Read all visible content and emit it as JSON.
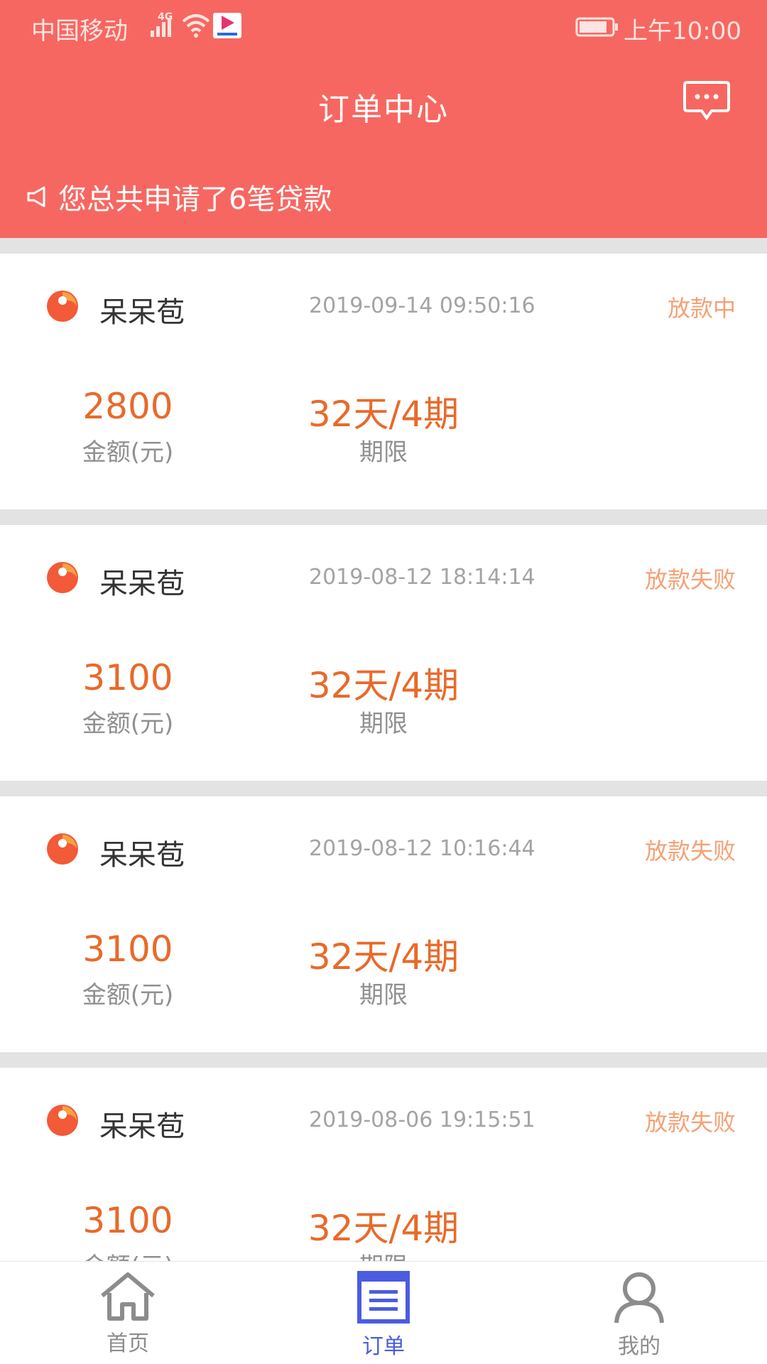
{
  "status_bar": {
    "carrier": "中国移动",
    "network": "4G",
    "time": "上午10:00",
    "icons": [
      "signal-icon",
      "wifi-icon",
      "youku-app-icon",
      "battery-icon"
    ]
  },
  "header": {
    "title": "订单中心",
    "message_icon": "chat-bubble-icon",
    "notice": "您总共申请了6笔贷款",
    "background_color": "#f76761"
  },
  "orders": [
    {
      "brand": "呆呆苞",
      "time": "2019-09-14 09:50:16",
      "status": "放款中",
      "amount": "2800",
      "amount_label": "金额(元)",
      "term": "32天/4期",
      "term_label": "期限"
    },
    {
      "brand": "呆呆苞",
      "time": "2019-08-12 18:14:14",
      "status": "放款失败",
      "amount": "3100",
      "amount_label": "金额(元)",
      "term": "32天/4期",
      "term_label": "期限"
    },
    {
      "brand": "呆呆苞",
      "time": "2019-08-12 10:16:44",
      "status": "放款失败",
      "amount": "3100",
      "amount_label": "金额(元)",
      "term": "32天/4期",
      "term_label": "期限"
    },
    {
      "brand": "呆呆苞",
      "time": "2019-08-06 19:15:51",
      "status": "放款失败",
      "amount": "3100",
      "amount_label": "金额(元)",
      "term": "32天/4期",
      "term_label": "期限"
    }
  ],
  "bottom_nav": {
    "items": [
      {
        "label": "首页",
        "icon": "home-icon",
        "active": false
      },
      {
        "label": "订单",
        "icon": "orders-icon",
        "active": true
      },
      {
        "label": "我的",
        "icon": "user-icon",
        "active": false
      }
    ],
    "active_color": "#4b5ce0",
    "inactive_color": "#8c8c8c"
  },
  "colors": {
    "accent": "#e86a2a",
    "status_text": "#f5a175",
    "separator": "#e3e3e3"
  }
}
